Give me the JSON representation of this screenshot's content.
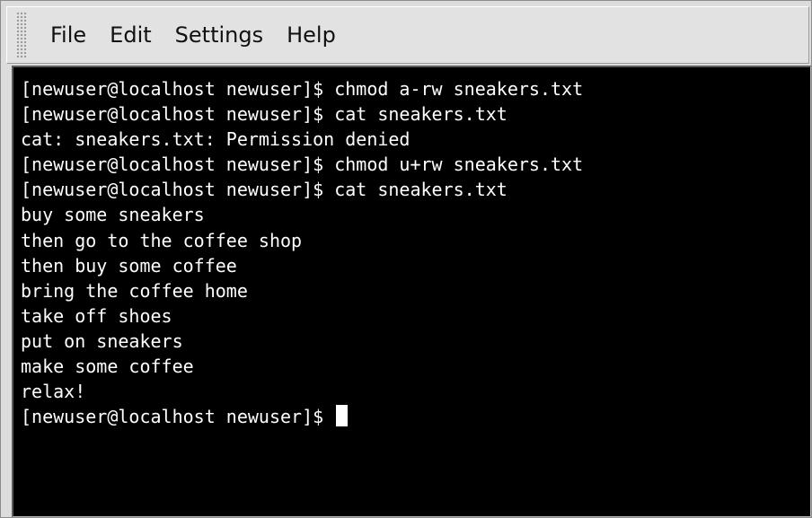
{
  "menu": {
    "items": [
      "File",
      "Edit",
      "Settings",
      "Help"
    ]
  },
  "terminal": {
    "lines": [
      "[newuser@localhost newuser]$ chmod a-rw sneakers.txt",
      "[newuser@localhost newuser]$ cat sneakers.txt",
      "cat: sneakers.txt: Permission denied",
      "[newuser@localhost newuser]$ chmod u+rw sneakers.txt",
      "[newuser@localhost newuser]$ cat sneakers.txt",
      "buy some sneakers",
      "then go to the coffee shop",
      "then buy some coffee",
      "bring the coffee home",
      "take off shoes",
      "put on sneakers",
      "make some coffee",
      "relax!"
    ],
    "prompt": "[newuser@localhost newuser]$ "
  },
  "colors": {
    "terminal_background": "#000000",
    "terminal_text": "#ffffff",
    "chrome": "#dcdcdc"
  }
}
